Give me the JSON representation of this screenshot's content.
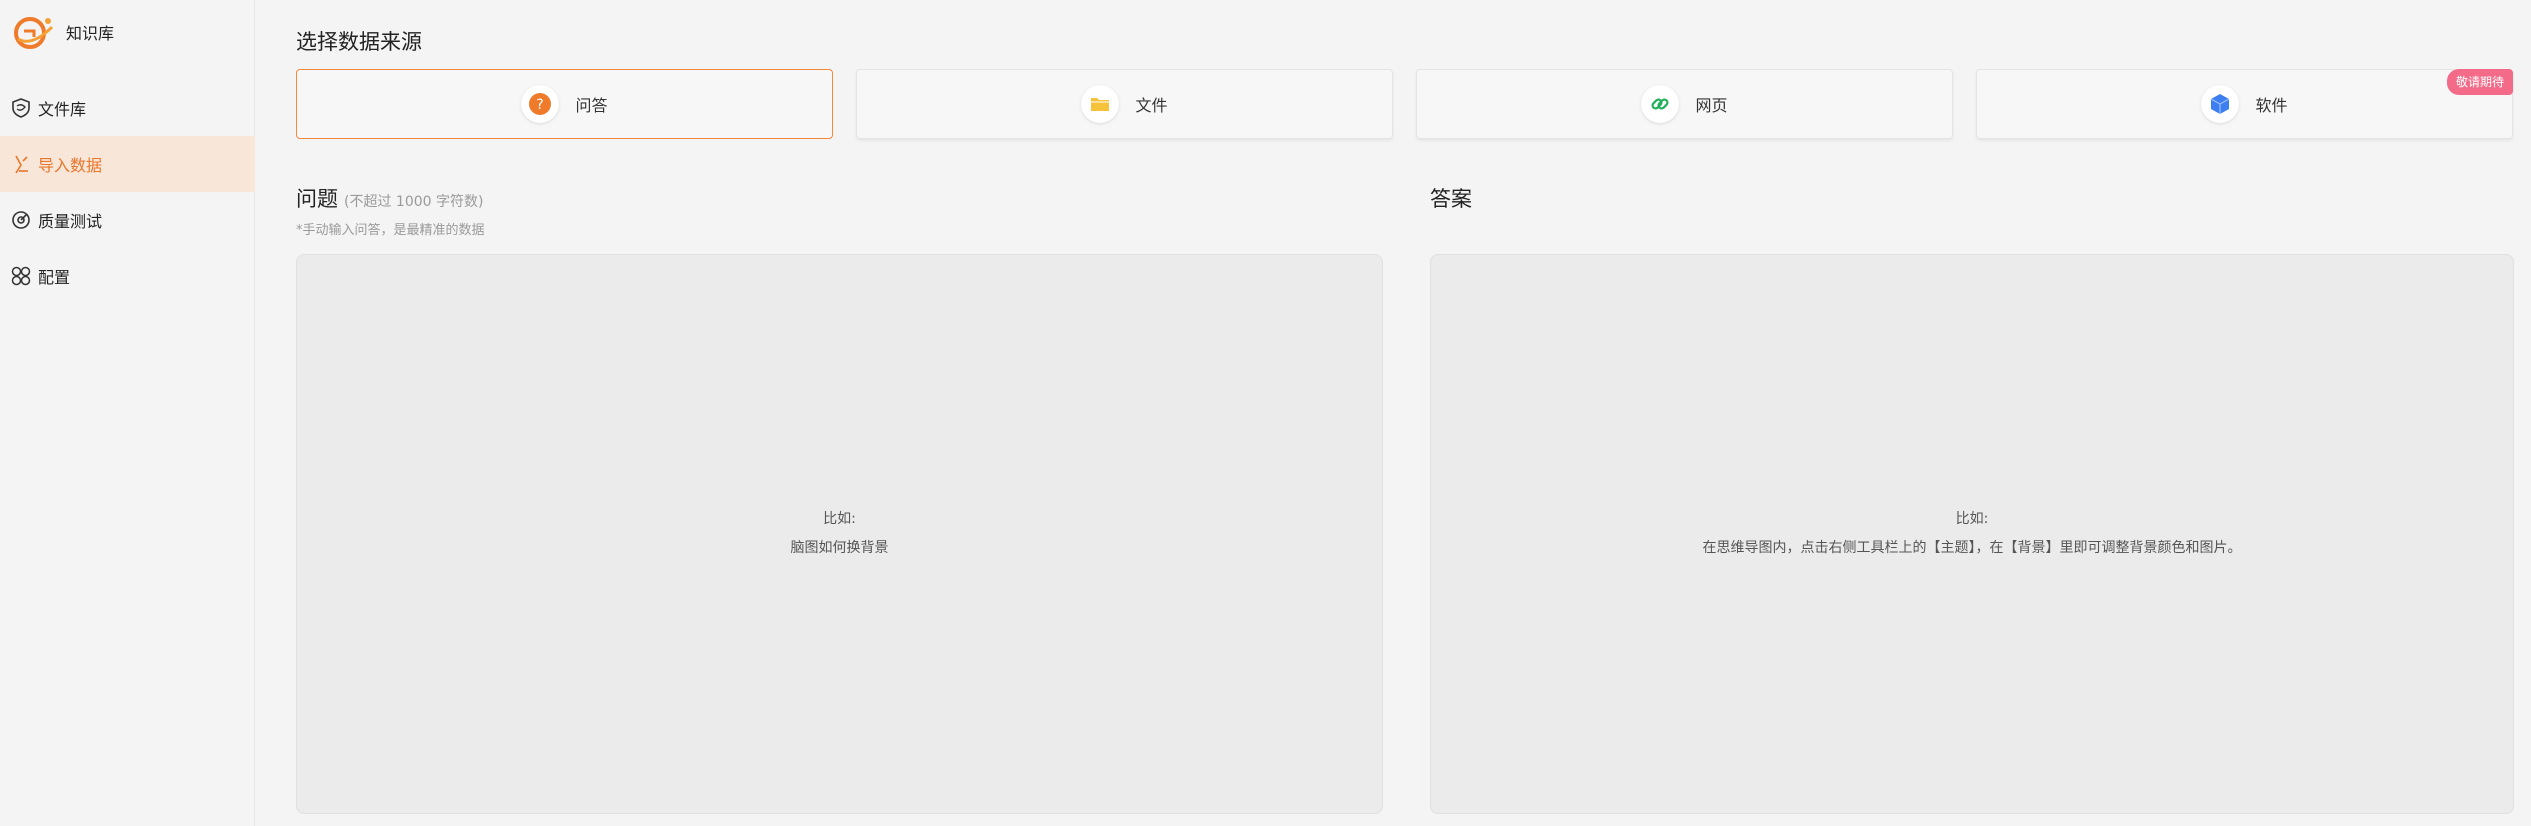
{
  "sidebar": {
    "brand": "知识库",
    "items": [
      {
        "label": "文件库",
        "icon": "shield-icon"
      },
      {
        "label": "导入数据",
        "icon": "import-icon",
        "active": true
      },
      {
        "label": "质量测试",
        "icon": "target-icon"
      },
      {
        "label": "配置",
        "icon": "grid-icon"
      }
    ]
  },
  "main": {
    "section_title": "选择数据来源",
    "sources": [
      {
        "label": "问答",
        "icon": "question-icon",
        "selected": true
      },
      {
        "label": "文件",
        "icon": "folder-icon"
      },
      {
        "label": "网页",
        "icon": "link-icon"
      },
      {
        "label": "软件",
        "icon": "cube-icon",
        "badge": "敬请期待"
      }
    ],
    "question": {
      "title": "问题",
      "subtitle": "(不超过 1000 字符数)",
      "hint": "*手动输入问答，是最精准的数据",
      "placeholder_line1": "比如:",
      "placeholder_line2": "脑图如何换背景"
    },
    "answer": {
      "title": "答案",
      "placeholder_line1": "比如:",
      "placeholder_line2": "在思维导图内，点击右侧工具栏上的【主题】，在【背景】里即可调整背景颜色和图片。"
    }
  },
  "colors": {
    "accent": "#f08a3c",
    "active_bg": "#f8e6d8",
    "badge": "#f46b8a",
    "link": "#23b05a",
    "cube": "#3d7ef0",
    "folder": "#f5c23a"
  }
}
